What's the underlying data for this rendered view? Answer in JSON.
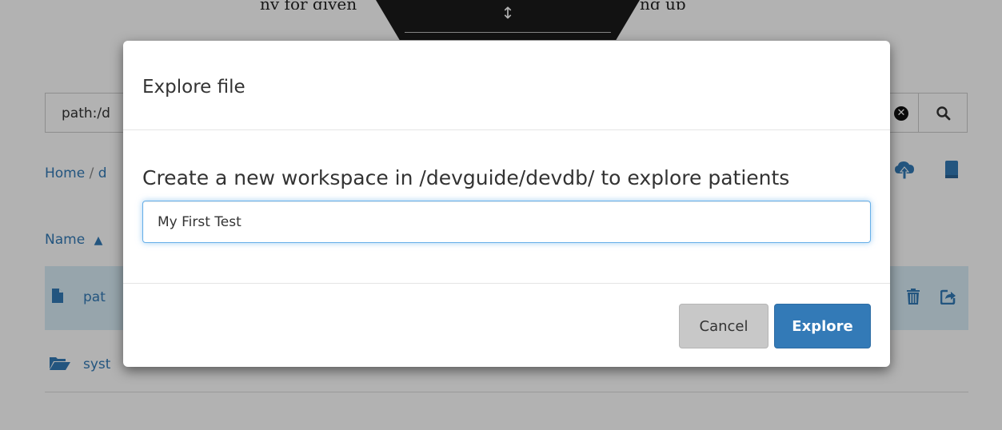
{
  "background": {
    "search": {
      "value": "path:/d"
    },
    "breadcrumb": {
      "home": "Home",
      "separator": "/",
      "current": "d"
    },
    "columns": {
      "name_header": "Name"
    },
    "rows": [
      {
        "name": "pat",
        "icon": "file-icon",
        "selected": true
      },
      {
        "name": "syst",
        "icon": "folder-icon",
        "selected": false
      }
    ],
    "icons": [
      "search-clear-icon",
      "search-icon",
      "cloud-upload-icon",
      "book-icon",
      "trash-icon",
      "export-icon",
      "drag-resize-icon"
    ]
  },
  "modal": {
    "title": "Explore file",
    "label": "Create a new workspace in /devguide/devdb/ to explore patients",
    "input_value": "My First Test",
    "cancel_label": "Cancel",
    "explore_label": "Explore"
  },
  "colors": {
    "primary": "#337ab7",
    "selected_row": "#d9edf7",
    "cancel_bg": "#c8c8c8",
    "backdrop": "rgba(0,0,0,0.3)"
  }
}
